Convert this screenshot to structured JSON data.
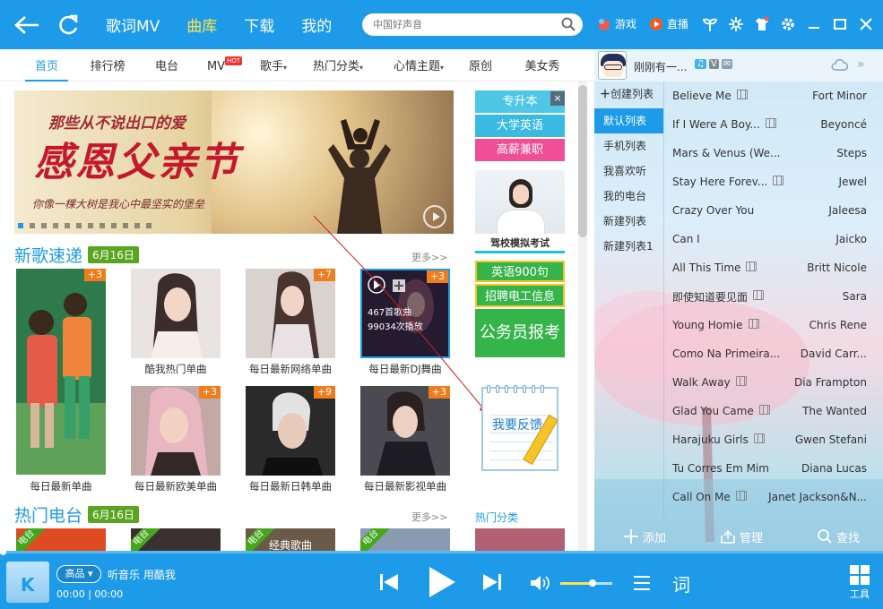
{
  "titlebar": {
    "nav": [
      "歌词MV",
      "曲库",
      "下载",
      "我的"
    ],
    "active_nav": "曲库",
    "search_placeholder": "中国好声音",
    "game_label": "游戏",
    "live_label": "直播"
  },
  "tabs": [
    "首页",
    "排行榜",
    "电台",
    "MV",
    "歌手",
    "热门分类",
    "心情主题",
    "原创",
    "美女秀"
  ],
  "tab_hot_badge": "HOT",
  "banner": {
    "top_text": "那些从不说出口的爱",
    "main_text": "感恩父亲节",
    "sub_text": "你像一棵大树是我心中最坚实的堡垒"
  },
  "side_ads": {
    "buttons": [
      {
        "label": "专升本",
        "color": "#4ec7e6"
      },
      {
        "label": "大学英语",
        "color": "#3ab9e3"
      },
      {
        "label": "高薪兼职",
        "color": "#f04f95"
      }
    ],
    "close": "×",
    "person_label": "驾校模拟考试",
    "english": "英语900句",
    "jobs": "招聘电工信息",
    "civil": "公务员报考"
  },
  "new_songs": {
    "title": "新歌速递",
    "date": "6月16日",
    "more": "更多>>",
    "hover_count": "467首歌曲",
    "hover_plays": "99034次播放",
    "tiles": [
      {
        "caption": "每日最新单曲",
        "badge": "+3"
      },
      {
        "caption": "酷我热门单曲",
        "badge": ""
      },
      {
        "caption": "每日最新网络单曲",
        "badge": "+7"
      },
      {
        "caption": "每日最新DJ舞曲",
        "badge": "+3"
      },
      {
        "caption": "每日最新欧美单曲",
        "badge": "+3"
      },
      {
        "caption": "每日最新日韩单曲",
        "badge": "+9"
      },
      {
        "caption": "每日最新影视单曲",
        "badge": "+3"
      }
    ]
  },
  "feedback": "我要反馈",
  "hot_radio": {
    "title": "热门电台",
    "date": "6月16日",
    "more": "更多>>",
    "ribbon": "电台",
    "album_text": "经典歌曲"
  },
  "hot_category": "热门分类",
  "right_panel": {
    "user_name": "刚刚有一...",
    "vip_badge": "V",
    "create_list": "创建列表",
    "lists": [
      "默认列表",
      "手机列表",
      "我喜欢听",
      "我的电台",
      "新建列表",
      "新建列表1"
    ],
    "active_list": "默认列表",
    "songs": [
      {
        "title": "Believe Me",
        "artist": "Fort Minor",
        "mv": true
      },
      {
        "title": "If I Were A Boy...",
        "artist": "Beyoncé",
        "mv": true
      },
      {
        "title": "Mars & Venus (We...",
        "artist": "Steps",
        "mv": false
      },
      {
        "title": "Stay Here Forev...",
        "artist": "Jewel",
        "mv": true
      },
      {
        "title": "Crazy Over You",
        "artist": "Jaleesa",
        "mv": false
      },
      {
        "title": "Can I",
        "artist": "Jaicko",
        "mv": false
      },
      {
        "title": "All This Time",
        "artist": "Britt Nicole",
        "mv": true
      },
      {
        "title": "即使知道要见面",
        "artist": "Sara",
        "mv": true
      },
      {
        "title": "Young Homie",
        "artist": "Chris Rene",
        "mv": true
      },
      {
        "title": "Como Na Primeira...",
        "artist": "David Carr...",
        "mv": false
      },
      {
        "title": "Walk Away",
        "artist": "Dia Frampton",
        "mv": true
      },
      {
        "title": "Glad You Came",
        "artist": "The Wanted",
        "mv": true
      },
      {
        "title": "Harajuku Girls",
        "artist": "Gwen Stefani",
        "mv": true
      },
      {
        "title": "Tu Corres Em Mim",
        "artist": "Diana Lucas",
        "mv": false
      },
      {
        "title": "Call On Me",
        "artist": "Janet Jackson&N...",
        "mv": true
      }
    ],
    "add": "添加",
    "manage": "管理",
    "find": "查找"
  },
  "player": {
    "quality": "高品",
    "title": "听音乐 用酷我",
    "time": "00:00 | 00:00",
    "lyric": "词",
    "tools": "工具",
    "volume_level": 0.62,
    "progress": 0
  }
}
